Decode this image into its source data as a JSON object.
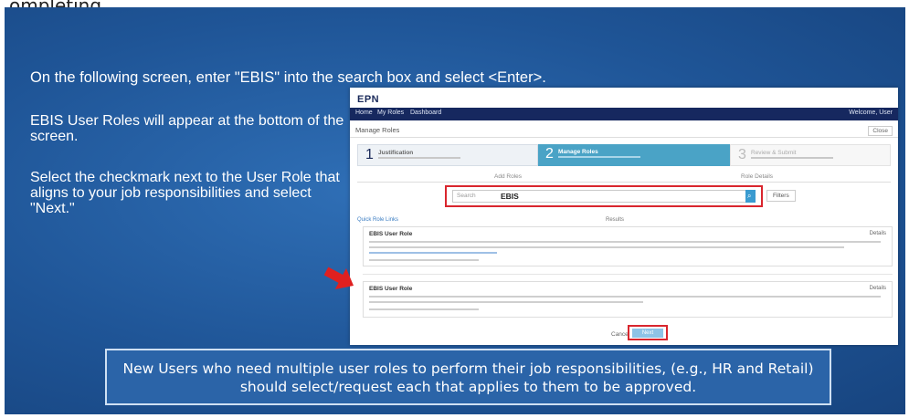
{
  "top_heading": "ompleting",
  "instruction": "On the following screen, enter \"EBIS\" into the search box and select <Enter>.",
  "side_text_1": "EBIS User Roles will appear at the bottom of the screen.",
  "side_text_2": "Select the checkmark next to the User Role that aligns to your job responsibilities and select \"Next.\"",
  "note": "New Users who need multiple user roles to perform their job responsibilities, (e.g., HR and Retail) should select/request each that applies to them to be approved.",
  "screenshot": {
    "logo": "EPN",
    "nav": [
      "Home",
      "My Roles",
      "Dashboard"
    ],
    "user": "Welcome, User",
    "page_title": "Manage Roles",
    "close": "Close",
    "steps": [
      {
        "num": "1",
        "label": "Justification"
      },
      {
        "num": "2",
        "label": "Manage Roles"
      },
      {
        "num": "3",
        "label": "Review & Submit"
      }
    ],
    "tabs": [
      "Add Roles",
      "Role Details"
    ],
    "search_placeholder": "Search",
    "search_value": "EBIS",
    "filter": "Filters",
    "results_links": "Quick Role Links",
    "results_count": "Results",
    "card1_title": "EBIS User Role",
    "card2_title": "EBIS User Role",
    "card_action": "Details",
    "cancel": "Cancel",
    "next": "Next"
  },
  "colors": {
    "slide": "#1f5597",
    "nav": "#16285f",
    "active_step": "#4aa3c6",
    "highlight": "#d9262e",
    "arrow": "#e02020"
  }
}
